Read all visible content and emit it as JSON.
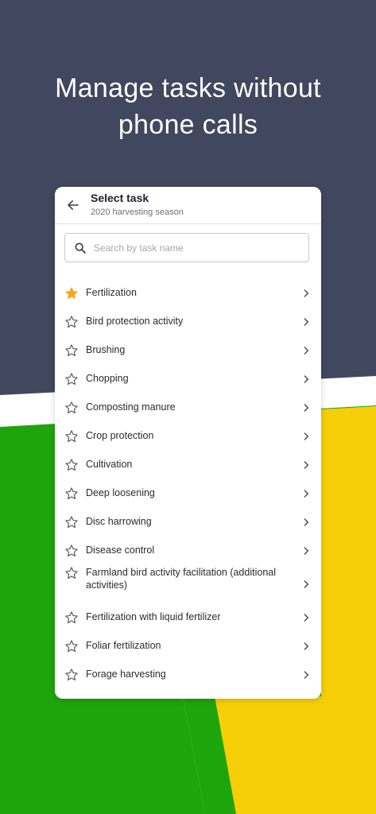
{
  "headline": {
    "line1": "Manage tasks without",
    "line2": "phone calls"
  },
  "colors": {
    "navy": "#41475e",
    "green": "#1fa50c",
    "yellow": "#f7cf08",
    "star_filled": "#f5a623",
    "star_outline": "#5a5a66"
  },
  "header": {
    "back_icon": "arrow-left-icon",
    "title": "Select task",
    "subtitle": "2020 harvesting season"
  },
  "search": {
    "icon": "search-icon",
    "placeholder": "Search by task name",
    "value": ""
  },
  "tasks": [
    {
      "label": "Fertilization",
      "favorite": true
    },
    {
      "label": "Bird protection activity",
      "favorite": false
    },
    {
      "label": "Brushing",
      "favorite": false
    },
    {
      "label": "Chopping",
      "favorite": false
    },
    {
      "label": "Composting manure",
      "favorite": false
    },
    {
      "label": "Crop protection",
      "favorite": false
    },
    {
      "label": "Cultivation",
      "favorite": false
    },
    {
      "label": "Deep loosening",
      "favorite": false
    },
    {
      "label": "Disc harrowing",
      "favorite": false
    },
    {
      "label": "Disease control",
      "favorite": false
    },
    {
      "label": "Farmland bird activity facilitation (additional activities)",
      "favorite": false
    },
    {
      "label": "Fertilization with liquid fertilizer",
      "favorite": false
    },
    {
      "label": "Foliar fertilization",
      "favorite": false
    },
    {
      "label": "Forage harvesting",
      "favorite": false
    }
  ]
}
